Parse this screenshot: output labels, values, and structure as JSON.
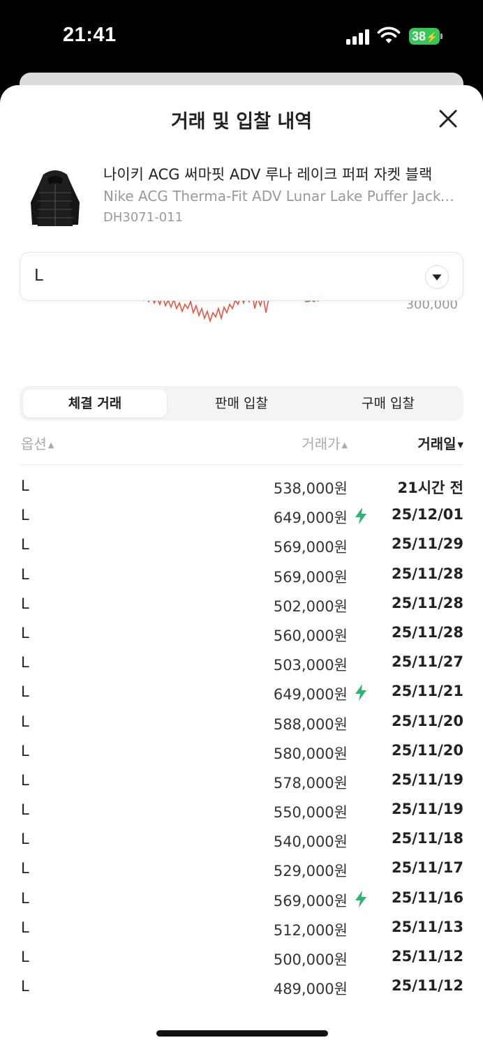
{
  "status_bar": {
    "time": "21:41",
    "battery": "38"
  },
  "sheet": {
    "title": "거래 및 입찰 내역",
    "close_icon": "close-icon"
  },
  "product": {
    "name_ko": "나이키 ACG 써마핏 ADV 루나 레이크 퍼퍼 자켓 블랙",
    "name_en": "Nike ACG Therma-Fit ADV Lunar Lake Puffer Jacket Black",
    "code": "DH3071-011"
  },
  "size_select": {
    "value": "L",
    "icon": "chevron-down-icon"
  },
  "chart": {
    "tick_label": "300,000"
  },
  "tabs": [
    {
      "label": "체결 거래",
      "active": true
    },
    {
      "label": "판매 입찰",
      "active": false
    },
    {
      "label": "구매 입찰",
      "active": false
    }
  ],
  "table": {
    "headers": {
      "option": "옵션",
      "price": "거래가",
      "date": "거래일"
    },
    "rows": [
      {
        "option": "L",
        "price": "538,000원",
        "fast": false,
        "date": "21시간 전"
      },
      {
        "option": "L",
        "price": "649,000원",
        "fast": true,
        "date": "25/12/01"
      },
      {
        "option": "L",
        "price": "569,000원",
        "fast": false,
        "date": "25/11/29"
      },
      {
        "option": "L",
        "price": "569,000원",
        "fast": false,
        "date": "25/11/28"
      },
      {
        "option": "L",
        "price": "502,000원",
        "fast": false,
        "date": "25/11/28"
      },
      {
        "option": "L",
        "price": "560,000원",
        "fast": false,
        "date": "25/11/28"
      },
      {
        "option": "L",
        "price": "503,000원",
        "fast": false,
        "date": "25/11/27"
      },
      {
        "option": "L",
        "price": "649,000원",
        "fast": true,
        "date": "25/11/21"
      },
      {
        "option": "L",
        "price": "588,000원",
        "fast": false,
        "date": "25/11/20"
      },
      {
        "option": "L",
        "price": "580,000원",
        "fast": false,
        "date": "25/11/20"
      },
      {
        "option": "L",
        "price": "578,000원",
        "fast": false,
        "date": "25/11/19"
      },
      {
        "option": "L",
        "price": "550,000원",
        "fast": false,
        "date": "25/11/19"
      },
      {
        "option": "L",
        "price": "540,000원",
        "fast": false,
        "date": "25/11/18"
      },
      {
        "option": "L",
        "price": "529,000원",
        "fast": false,
        "date": "25/11/17"
      },
      {
        "option": "L",
        "price": "569,000원",
        "fast": true,
        "date": "25/11/16"
      },
      {
        "option": "L",
        "price": "512,000원",
        "fast": false,
        "date": "25/11/13"
      },
      {
        "option": "L",
        "price": "500,000원",
        "fast": false,
        "date": "25/11/12"
      },
      {
        "option": "L",
        "price": "489,000원",
        "fast": false,
        "date": "25/11/12"
      }
    ]
  },
  "colors": {
    "fast_delivery": "#31b46e",
    "chart_line": "#e8553e",
    "battery": "#34c759"
  }
}
